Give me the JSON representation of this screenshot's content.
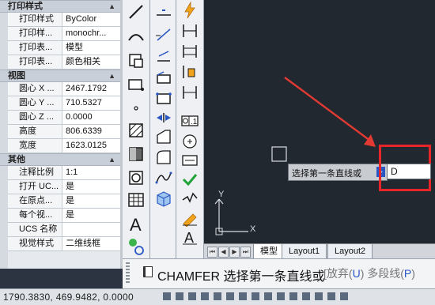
{
  "properties": {
    "print_style": {
      "header": "打印样式",
      "rows": [
        {
          "key": "打印样式",
          "value": "ByColor"
        },
        {
          "key": "打印样...",
          "value": "monochr..."
        },
        {
          "key": "打印表...",
          "value": "模型"
        },
        {
          "key": "打印表...",
          "value": "颜色相关"
        }
      ]
    },
    "view": {
      "header": "视图",
      "rows": [
        {
          "key": "圆心 X ...",
          "value": "2467.1792"
        },
        {
          "key": "圆心 Y ...",
          "value": "710.5327"
        },
        {
          "key": "圆心 Z ...",
          "value": "0.0000"
        },
        {
          "key": "高度",
          "value": "806.6339"
        },
        {
          "key": "宽度",
          "value": "1623.0125"
        }
      ]
    },
    "misc": {
      "header": "其他",
      "rows": [
        {
          "key": "注释比例",
          "value": "1:1"
        },
        {
          "key": "打开 UC...",
          "value": "是"
        },
        {
          "key": "在原点...",
          "value": "是"
        },
        {
          "key": "每个视...",
          "value": "是"
        },
        {
          "key": "UCS 名称",
          "value": ""
        },
        {
          "key": "视觉样式",
          "value": "二维线框"
        }
      ]
    }
  },
  "drawing": {
    "prompt_label": "选择第一条直线或",
    "input_value": "D",
    "ucs_y": "Y",
    "ucs_x": "X"
  },
  "layout_tabs": [
    "模型",
    "Layout1",
    "Layout2"
  ],
  "command_line": {
    "text": "CHAMFER 选择第一条直线或",
    "options_prefix": "[放弃(",
    "opt_key1": "U",
    "options_mid": ") 多段线(",
    "opt_key2": "P",
    "options_suffix": ")"
  },
  "status_bar": {
    "coords": "1790.3830, 469.9482, 0.0000"
  },
  "colors": {
    "canvas_bg": "#212830",
    "highlight_red": "#e8262a",
    "arrow_red": "#e03a32"
  }
}
